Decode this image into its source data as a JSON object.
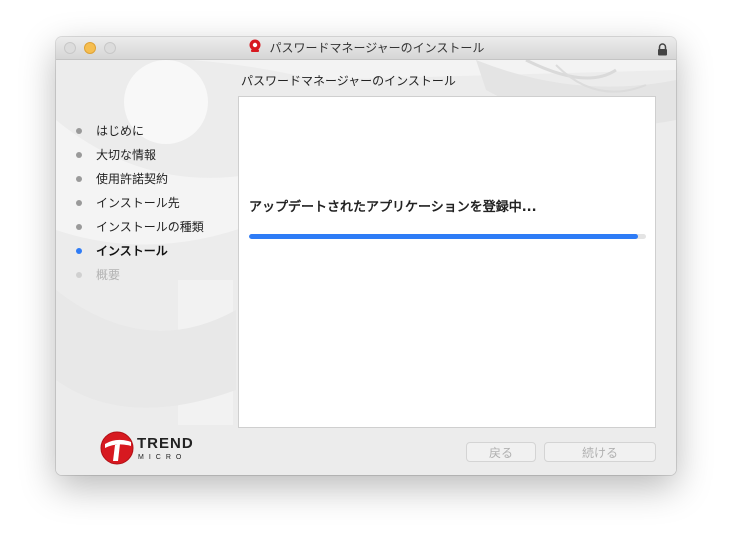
{
  "window": {
    "title": "パスワードマネージャーのインストール",
    "title_icon": "trend-micro-password-manager-icon",
    "lock_icon": "lock-icon"
  },
  "header": {
    "text": "パスワードマネージャーのインストール"
  },
  "sidebar": {
    "steps": [
      {
        "label": "はじめに",
        "state": "done"
      },
      {
        "label": "大切な情報",
        "state": "done"
      },
      {
        "label": "使用許諾契約",
        "state": "done"
      },
      {
        "label": "インストール先",
        "state": "done"
      },
      {
        "label": "インストールの種類",
        "state": "done"
      },
      {
        "label": "インストール",
        "state": "active"
      },
      {
        "label": "概要",
        "state": "pending"
      }
    ]
  },
  "main": {
    "status": "アップデートされたアプリケーションを登録中...",
    "progress_percent": 98
  },
  "logo": {
    "brand": "TREND",
    "sub": "MICRO",
    "icon": "trend-micro-logo-icon"
  },
  "footer": {
    "back_label": "戻る",
    "continue_label": "続ける"
  },
  "colors": {
    "accent": "#2e7cf6",
    "brand_red": "#d71920"
  }
}
